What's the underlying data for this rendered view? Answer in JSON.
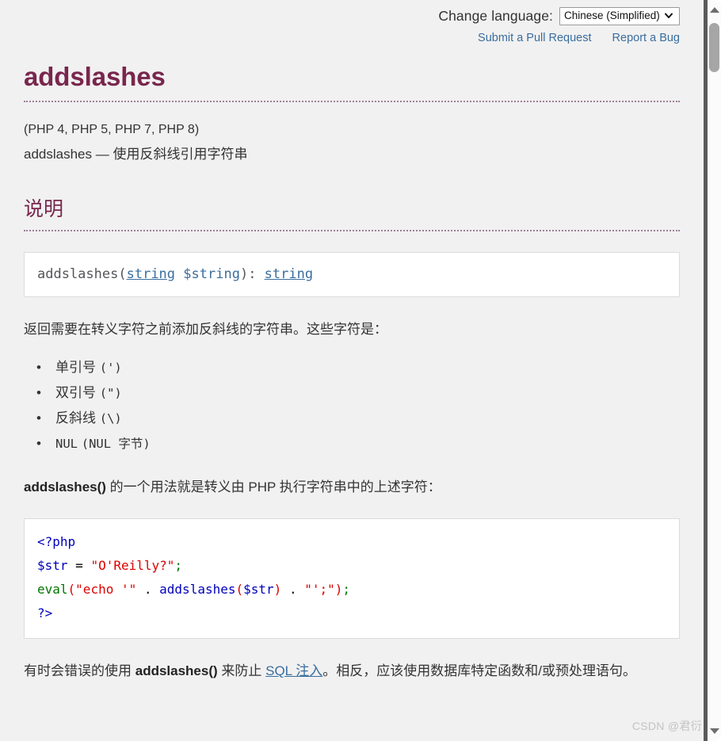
{
  "header": {
    "change_language_label": "Change language:",
    "language_selected": "Chinese (Simplified)",
    "language_options": [
      "Chinese (Simplified)"
    ],
    "submit_pr_link": "Submit a Pull Request",
    "report_bug_link": "Report a Bug"
  },
  "page": {
    "title": "addslashes",
    "versions": "(PHP 4, PHP 5, PHP 7, PHP 8)",
    "purpose": "addslashes — 使用反斜线引用字符串"
  },
  "description": {
    "heading": "说明",
    "synopsis": {
      "name": "addslashes",
      "open_paren": "(",
      "param_type": "string",
      "param_space": " ",
      "param_name": "$string",
      "close_paren": ")",
      "colon": ": ",
      "return_type": "string"
    },
    "intro": "返回需要在转义字符之前添加反斜线的字符串。这些字符是：",
    "char_list": [
      {
        "label": "单引号",
        "code": "(')"
      },
      {
        "label": "双引号",
        "code": "(\")"
      },
      {
        "label": "反斜线",
        "code": "(\\)"
      },
      {
        "label": "NUL",
        "code": "(NUL 字节)"
      }
    ],
    "usage_bold": "addslashes()",
    "usage_rest": " 的一个用法就是转义由 PHP 执行字符串中的上述字符：",
    "warning_pre": "有时会错误的使用 ",
    "warning_bold": "addslashes()",
    "warning_mid": " 来防止 ",
    "warning_link": "SQL 注入",
    "warning_post": "。相反，应该使用数据库特定函数和/或预处理语句。"
  },
  "code_example": {
    "lines": [
      [
        {
          "t": "<?php",
          "c": "c-tag"
        }
      ],
      [
        {
          "t": "$str",
          "c": "c-var"
        },
        {
          "t": " ",
          "c": "c-op"
        },
        {
          "t": "=",
          "c": "c-op"
        },
        {
          "t": " ",
          "c": "c-op"
        },
        {
          "t": "\"O'Reilly?\"",
          "c": "c-str"
        },
        {
          "t": ";",
          "c": "c-kw"
        }
      ],
      [
        {
          "t": "eval",
          "c": "c-kw"
        },
        {
          "t": "(",
          "c": "c-str"
        },
        {
          "t": "\"echo '\"",
          "c": "c-str"
        },
        {
          "t": " ",
          "c": "c-op"
        },
        {
          "t": ".",
          "c": "c-op"
        },
        {
          "t": " ",
          "c": "c-op"
        },
        {
          "t": "addslashes",
          "c": "c-fn"
        },
        {
          "t": "(",
          "c": "c-str"
        },
        {
          "t": "$str",
          "c": "c-var"
        },
        {
          "t": ")",
          "c": "c-str"
        },
        {
          "t": " ",
          "c": "c-op"
        },
        {
          "t": ".",
          "c": "c-op"
        },
        {
          "t": " ",
          "c": "c-op"
        },
        {
          "t": "\"';\"",
          "c": "c-str"
        },
        {
          "t": ")",
          "c": "c-str"
        },
        {
          "t": ";",
          "c": "c-kw"
        }
      ],
      [
        {
          "t": "?>",
          "c": "c-tag"
        }
      ]
    ]
  },
  "watermark": {
    "text": "CSDN @君衍"
  },
  "scrollbar": {
    "up_arrow": "scroll-up-arrow",
    "down_arrow": "scroll-down-arrow"
  },
  "colors": {
    "accent_purple": "#79264d",
    "link_blue": "#3a6d9e",
    "page_bg": "#f1f1f1",
    "box_bg": "#ffffff",
    "text": "#333333"
  }
}
